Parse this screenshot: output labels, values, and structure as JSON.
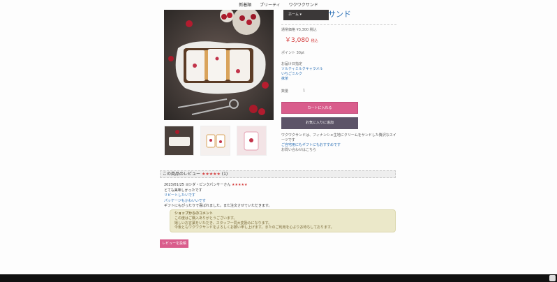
{
  "nav": [
    "新着順",
    "ブリーティ",
    "ワクワクサンド"
  ],
  "product": {
    "title": "ンド",
    "title_suffix": "サンド",
    "dropdown_label": "ホーム ▾",
    "sub_price_label": "通常価格 ¥3,300 税込",
    "price": "￥3,080",
    "price_tax": "税込",
    "shipping": "ポイント 30pt",
    "notes_label": "お届け日指定",
    "links": [
      "ソルティミルクキャラメル",
      "いちごミルク",
      "抹茶"
    ],
    "qty_label": "数量",
    "qty_value": "1",
    "cart_button": "カートに入れる",
    "fav_button": "お気に入りに追加",
    "desc_line1": "ワクワクサンドは、フィナンシェ生地にクリームをサンドした贅沢なスイーツです",
    "desc_line2": "ご自宅用にもギフトにもおすすめです",
    "desc_line3": "お問い合わせはこちら"
  },
  "review": {
    "header": "この商品のレビュー",
    "stars": "★★★★★",
    "count": "(1)",
    "author": "2023/01/25 ヨシダ・ピンクパンサーさん",
    "author_stars": "★★★★★",
    "line1": "とても美味しかったです",
    "line2": "リピートしたいです",
    "line3": "パッケージもかわいいです",
    "line4": "ギフトにもぴったりで喜ばれました。また注文させていただきます。",
    "reply_title": "ショップからのコメント",
    "reply_lines": [
      "この度はご購入ありがとうございます。",
      "嬉しいお言葉をいただき、スタッフ一同大変励みになります。",
      "今後ともワクワクサンドをよろしくお願い申し上げます。またのご利用を心よりお待ちしております。"
    ],
    "write_button": "レビューを投稿"
  },
  "colors": {
    "accent": "#d95d8c",
    "price": "#d43b3b",
    "link": "#2a6fb5"
  }
}
